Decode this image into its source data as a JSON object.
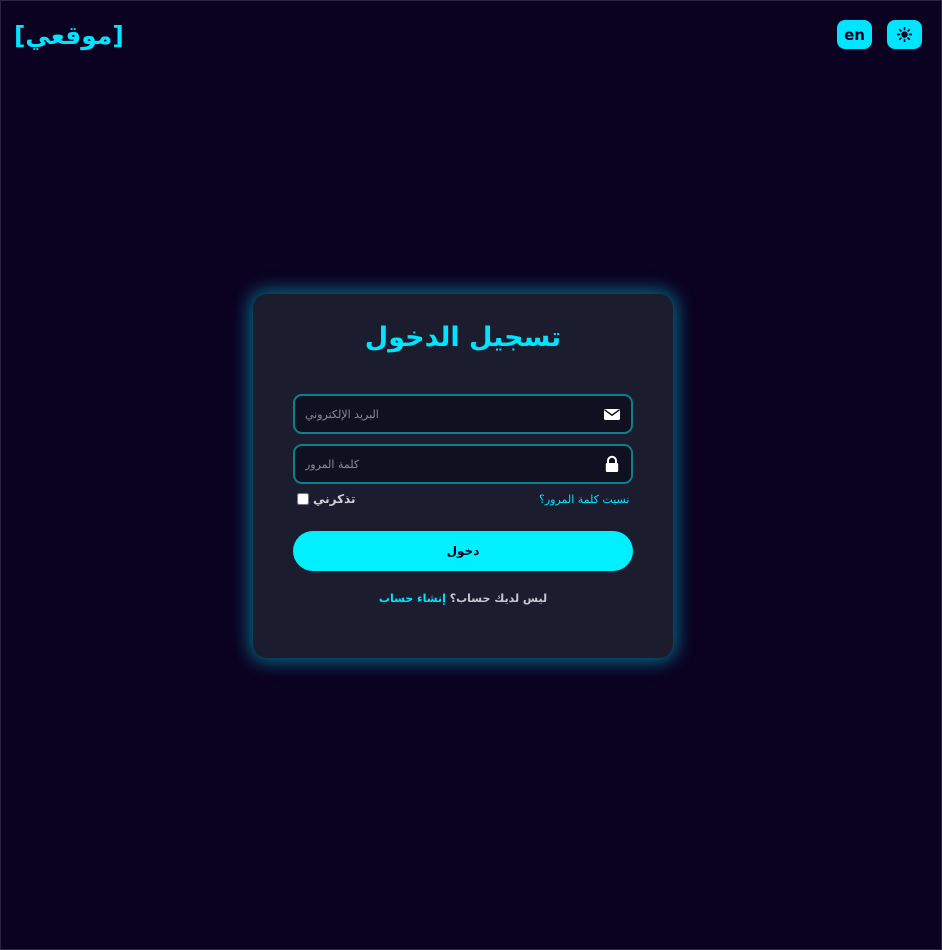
{
  "header": {
    "logo_text": "[موقعي]",
    "lang_button_label": "en",
    "theme_icon": "sun-icon"
  },
  "login": {
    "title": "تسجيل الدخول",
    "email_placeholder": "البريد الإلكتروني",
    "email_icon": "envelope-icon",
    "password_placeholder": "كلمة المرور",
    "password_icon": "lock-icon",
    "forgot_password": "نسيت كلمة المرور؟",
    "remember_me": "تذكرني",
    "submit_label": "دخول",
    "no_account_text": "ليس لديك حساب؟",
    "signup_link": "إنشاء حساب"
  },
  "colors": {
    "background": "#0b0120",
    "card": "#1b1c2e",
    "accent": "#00e5ff",
    "field_border": "#0e7f8c"
  }
}
